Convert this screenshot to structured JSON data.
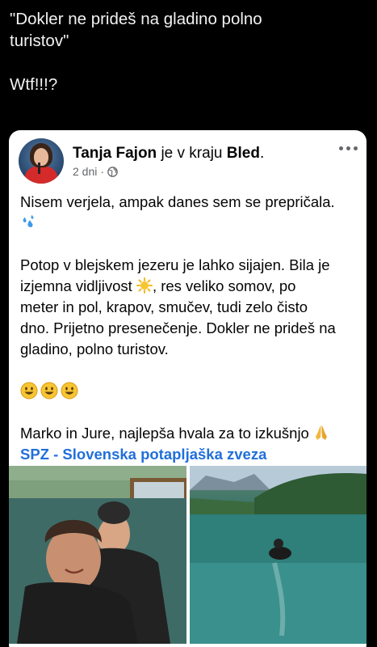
{
  "tweet": {
    "line1": "\"Dokler ne prideš na gladino polno",
    "line2": "turistov\"",
    "line3": "Wtf!!!?"
  },
  "post": {
    "author": "Tanja Fajon",
    "location_prefix": "je v kraju",
    "location": "Bled",
    "location_suffix": ".",
    "time": "2 dni",
    "separator": "·",
    "visibility_icon": "globe-icon",
    "more_icon": "more-options-icon",
    "paragraphs": [
      "Nisem verjela, ampak danes sem se prepričala.",
      "Potop v blejskem jezeru je lahko sijajen. Bila je",
      "izjemna vidljivost",
      ", res veliko somov, po",
      "meter in pol, krapov, smučev, tudi zelo čisto",
      "dno. Prijetno presenečenje. Dokler ne prideš na",
      "gladino, polno turistov.",
      "Marko in Jure, najlepša hvala za to izkušnjo"
    ],
    "tag_link": "SPZ - Slovenska potapljaška zveza",
    "colors": {
      "link": "#216fdb",
      "meta": "#65676b",
      "text": "#050505"
    }
  },
  "photos": [
    {
      "name": "selfie-photo",
      "description_icon": "photo"
    },
    {
      "name": "lake-diver-photo",
      "description_icon": "photo"
    }
  ]
}
